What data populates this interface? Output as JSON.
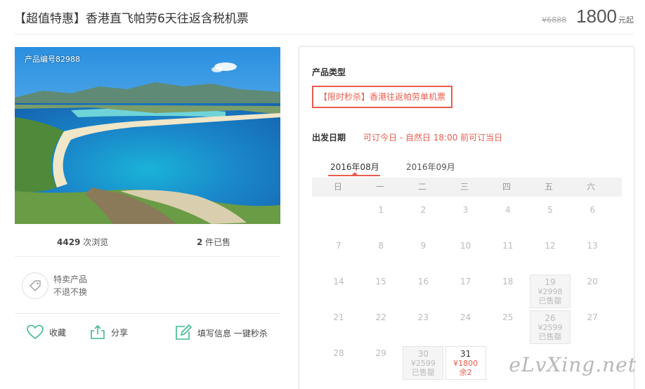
{
  "header": {
    "title": "【超值特惠】香港直飞帕劳6天往返含税机票",
    "old_price": "¥6888",
    "price": "1800",
    "price_unit": "元起"
  },
  "photo": {
    "tag": "产品编号82988"
  },
  "stats": {
    "views_num": "4429",
    "views_label": " 次浏览",
    "sold_num": "2",
    "sold_label": " 件已售"
  },
  "special": {
    "line1": "特卖产品",
    "line2": "不退不换"
  },
  "actions": {
    "favorite": "收藏",
    "share": "分享",
    "fill_info": "填写信息 一键秒杀"
  },
  "panel": {
    "product_type_label": "产品类型",
    "product_option": "【限时秒杀】香港往返帕劳单机票",
    "departure_label": "出发日期",
    "departure_note": "可订今日 - 自然日 18:00 前可订当日",
    "months": [
      "2016年08月",
      "2016年09月"
    ],
    "weekdays": [
      "日",
      "一",
      "二",
      "三",
      "四",
      "五",
      "六"
    ]
  },
  "calendar": {
    "days": [
      {
        "d": "1"
      },
      {
        "d": "2"
      },
      {
        "d": "3"
      },
      {
        "d": "4"
      },
      {
        "d": "5"
      },
      {
        "d": "6"
      },
      {
        "d": "7"
      },
      {
        "d": "8"
      },
      {
        "d": "9"
      },
      {
        "d": "10"
      },
      {
        "d": "11"
      },
      {
        "d": "12"
      },
      {
        "d": "13"
      },
      {
        "d": "14"
      },
      {
        "d": "15"
      },
      {
        "d": "16"
      },
      {
        "d": "17"
      },
      {
        "d": "18"
      },
      {
        "d": "19",
        "price": "¥2998",
        "status": "已售罄",
        "state": "sold"
      },
      {
        "d": "20"
      },
      {
        "d": "21"
      },
      {
        "d": "22"
      },
      {
        "d": "23"
      },
      {
        "d": "24"
      },
      {
        "d": "25"
      },
      {
        "d": "26",
        "price": "¥2599",
        "status": "已售罄",
        "state": "sold"
      },
      {
        "d": "27"
      },
      {
        "d": "28"
      },
      {
        "d": "29"
      },
      {
        "d": "30",
        "price": "¥2599",
        "status": "已售罄",
        "state": "sold"
      },
      {
        "d": "31",
        "price": "¥1800",
        "status": "余2",
        "state": "open"
      }
    ]
  },
  "watermark": "eLvXing.net",
  "colors": {
    "accent": "#e85d4f",
    "icon_green": "#3dbb8e"
  }
}
